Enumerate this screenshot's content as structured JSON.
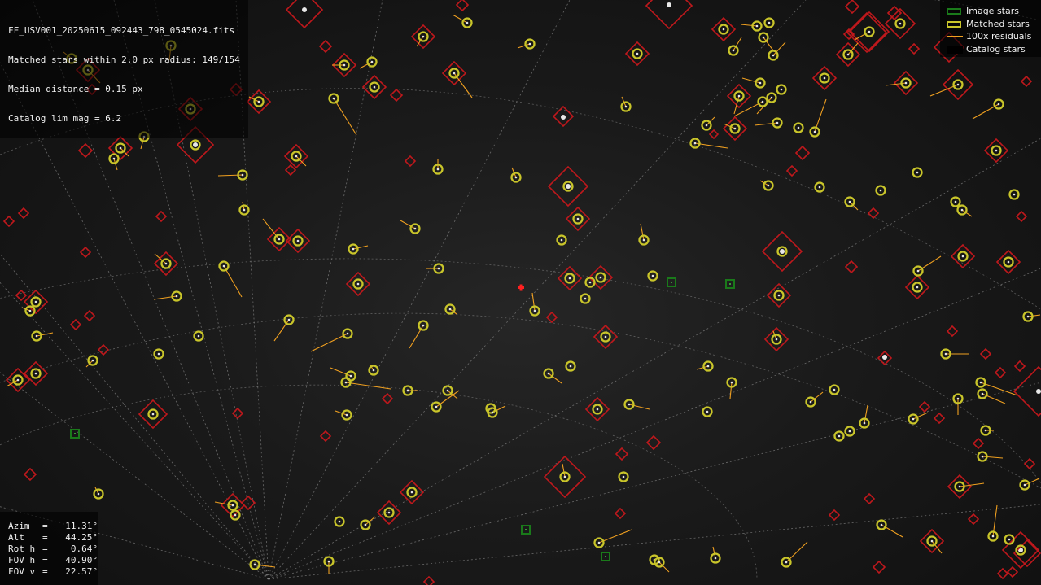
{
  "header": {
    "filename": "FF_USV001_20250615_092443_798_0545024.fits",
    "matched": "Matched stars within 2.0 px radius: 149/154",
    "median": "Median distance = 0.15 px",
    "limmag": "Catalog lim mag = 6.2"
  },
  "legend": {
    "items": [
      {
        "label": "Image stars",
        "color": "#1a7a1a"
      },
      {
        "label": "Matched stars",
        "color": "#c9c52a"
      },
      {
        "label": "100x residuals",
        "color": "#f0a020"
      },
      {
        "label": "Catalog stars",
        "color": "#000000"
      }
    ]
  },
  "pointing": {
    "rows": [
      {
        "key": "Azim",
        "val": "11.31°"
      },
      {
        "key": "Alt",
        "val": "44.25°"
      },
      {
        "key": "Rot h",
        "val": "0.64°"
      },
      {
        "key": "FOV h",
        "val": "40.90°"
      },
      {
        "key": "FOV v",
        "val": "22.57°"
      }
    ]
  },
  "colors": {
    "catalog": "#c0181c",
    "matched": "#c9c52a",
    "residual": "#f0a020",
    "image": "#1a7a1a",
    "grid": "#8a8a8a",
    "center": "#ff2020"
  }
}
